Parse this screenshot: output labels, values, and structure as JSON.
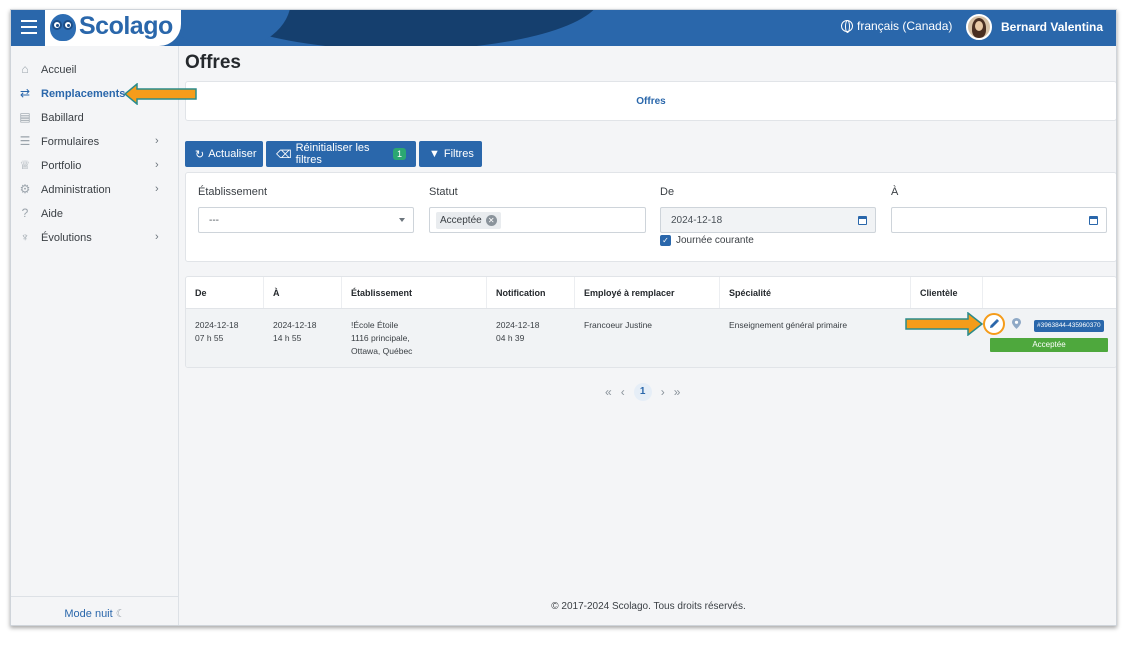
{
  "brand": {
    "name": "Scolago"
  },
  "header": {
    "language": "français (Canada)",
    "user_name": "Bernard Valentina"
  },
  "sidebar": {
    "items": [
      {
        "label": "Accueil",
        "icon": "home-icon",
        "has_children": false,
        "active": false
      },
      {
        "label": "Remplacements",
        "icon": "substitutions-icon",
        "has_children": false,
        "active": true
      },
      {
        "label": "Babillard",
        "icon": "board-icon",
        "has_children": false,
        "active": false
      },
      {
        "label": "Formulaires",
        "icon": "forms-icon",
        "has_children": true,
        "active": false
      },
      {
        "label": "Portfolio",
        "icon": "trophy-icon",
        "has_children": true,
        "active": false
      },
      {
        "label": "Administration",
        "icon": "gear-icon",
        "has_children": true,
        "active": false
      },
      {
        "label": "Aide",
        "icon": "question-icon",
        "has_children": false,
        "active": false
      },
      {
        "label": "Évolutions",
        "icon": "sprout-icon",
        "has_children": true,
        "active": false
      }
    ],
    "night_mode": "Mode nuit"
  },
  "page": {
    "title": "Offres",
    "breadcrumb": "Offres"
  },
  "toolbar": {
    "refresh": "Actualiser",
    "reset_filters": "Réinitialiser les filtres",
    "reset_count": "1",
    "filters": "Filtres"
  },
  "filters": {
    "etablissement_label": "Établissement",
    "etablissement_value": "---",
    "statut_label": "Statut",
    "statut_chip": "Acceptée",
    "from_label": "De",
    "from_value": "2024-12-18",
    "to_label": "À",
    "to_value": "",
    "current_day_label": "Journée courante",
    "current_day_checked": true
  },
  "table": {
    "columns": [
      "De",
      "À",
      "Établissement",
      "Notification",
      "Employé à remplacer",
      "Spécialité",
      "Clientèle",
      ""
    ],
    "rows": [
      {
        "from_date": "2024-12-18",
        "from_time": "07 h 55",
        "to_date": "2024-12-18",
        "to_time": "14 h 55",
        "school_name": "!École Étoile",
        "school_addr1": "1116 principale,",
        "school_addr2": "Ottawa, Québec",
        "notif_date": "2024-12-18",
        "notif_time": "04 h 39",
        "employee": "Francoeur Justine",
        "specialty": "Enseignement général primaire",
        "clientele": "",
        "id": "#3963844-435960370",
        "status": "Acceptée"
      }
    ]
  },
  "pagination": {
    "current": "1"
  },
  "footer": {
    "copyright": "© 2017-2024 Scolago. Tous droits réservés."
  },
  "colors": {
    "primary": "#2a67ab",
    "success": "#4ea83d",
    "highlight": "#f59c1a"
  }
}
